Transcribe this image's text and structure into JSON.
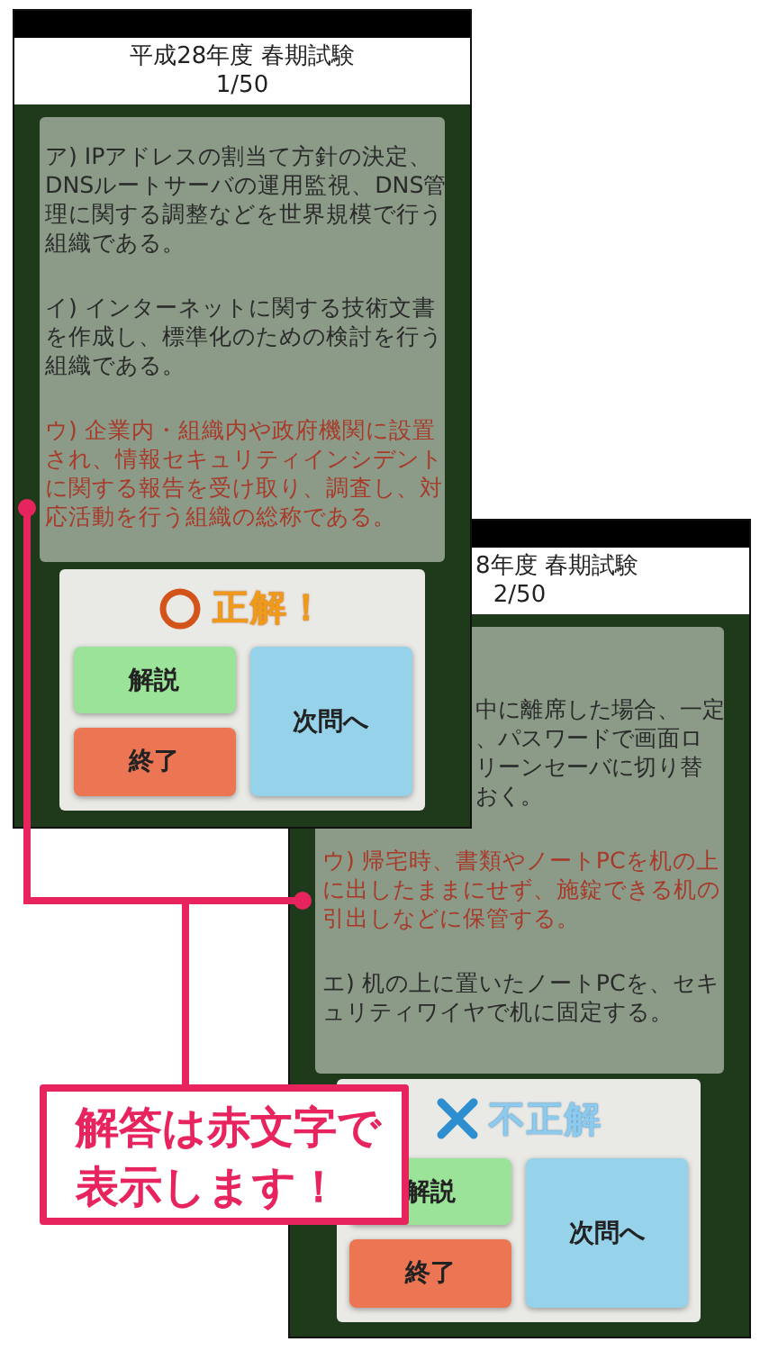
{
  "screens": [
    {
      "header": {
        "title": "平成28年度 春期試験",
        "title_cut": false,
        "counter": "1/50"
      },
      "options": [
        {
          "kind": "normal",
          "lines": [
            "ア) IPアドレスの割当て方針の決定、",
            "DNSルートサーバの運用監視、DNS管",
            "理に関する調整などを世界規模で行う",
            "組織である。"
          ]
        },
        {
          "kind": "normal",
          "lines": [
            "イ) インターネットに関する技術文書",
            "を作成し、標準化のための検討を行う",
            "組織である。"
          ]
        },
        {
          "kind": "answer",
          "lines": [
            "ウ) 企業内・組織内や政府機関に設置",
            "され、情報セキュリティインシデント",
            "に関する報告を受け取り、調査し、対",
            "応活動を行う組織の総称である。"
          ]
        }
      ],
      "dialog": {
        "result": {
          "kind": "correct",
          "label": "正解！"
        },
        "buttons": [
          {
            "kind": "explain",
            "label": "解説"
          },
          {
            "kind": "quit",
            "label": "終了"
          },
          {
            "kind": "next",
            "label": "次問へ"
          }
        ]
      }
    },
    {
      "header": {
        "title": "8年度 春期試験",
        "title_cut": true,
        "counter": "2/50"
      },
      "options": [
        {
          "kind": "clipped",
          "lines": [
            "中に離席した場合、一定",
            "、パスワードで画面ロ",
            "リーンセーバに切り替",
            "おく。"
          ]
        },
        {
          "kind": "answer",
          "lines": [
            "ウ) 帰宅時、書類やノートPCを机の上",
            "に出したままにせず、施錠できる机の",
            "引出しなどに保管する。"
          ]
        },
        {
          "kind": "normal",
          "lines": [
            "エ) 机の上に置いたノートPCを、セキ",
            "ュリティワイヤで机に固定する。"
          ]
        }
      ],
      "dialog": {
        "result": {
          "kind": "incorrect",
          "label": "不正解"
        },
        "buttons": [
          {
            "kind": "explain",
            "label": "解説"
          },
          {
            "kind": "quit",
            "label": "終了"
          },
          {
            "kind": "next",
            "label": "次問へ"
          }
        ]
      }
    }
  ],
  "callout": {
    "lines": [
      "解答は赤文字で",
      "表示します！"
    ]
  }
}
